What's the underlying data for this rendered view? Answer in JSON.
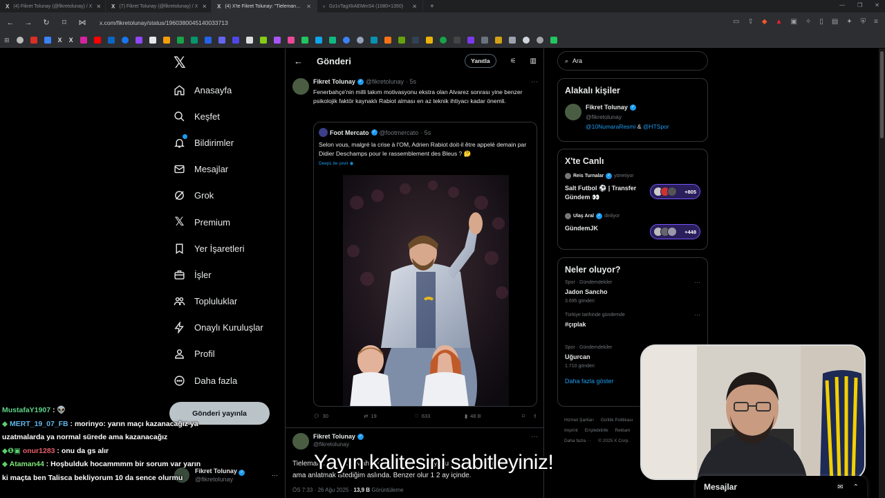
{
  "browser": {
    "tabs": [
      {
        "title": "(4) Fikret Tolunay (@fikretolunay) / X",
        "active": false
      },
      {
        "title": "(7) Fikret Tolunay (@fikretolunay) / X",
        "active": false
      },
      {
        "title": "(4) X'te Fikret Tolunay: \"Tieleman…",
        "active": true
      },
      {
        "title": "Gz1vTagXkAEMmS4 (1080×1350)",
        "active": false
      }
    ],
    "url": "x.com/fikretolunay/status/1960380045140033713"
  },
  "sidebar": {
    "items": [
      {
        "label": "Anasayfa",
        "icon": "home-icon"
      },
      {
        "label": "Keşfet",
        "icon": "search-icon"
      },
      {
        "label": "Bildirimler",
        "icon": "bell-icon"
      },
      {
        "label": "Mesajlar",
        "icon": "mail-icon"
      },
      {
        "label": "Grok",
        "icon": "grok-icon"
      },
      {
        "label": "Premium",
        "icon": "x-icon"
      },
      {
        "label": "Yer İşaretleri",
        "icon": "bookmark-icon"
      },
      {
        "label": "İşler",
        "icon": "briefcase-icon"
      },
      {
        "label": "Topluluklar",
        "icon": "people-icon"
      },
      {
        "label": "Onaylı Kuruluşlar",
        "icon": "lightning-icon"
      },
      {
        "label": "Profil",
        "icon": "person-icon"
      },
      {
        "label": "Daha fazla",
        "icon": "more-circle-icon"
      }
    ],
    "post_button": "Gönderi yayınla",
    "account": {
      "name": "Fikret Tolunay",
      "handle": "@fikretolunay"
    }
  },
  "main": {
    "title": "Gönderi",
    "reply_label": "Yanıtla",
    "tweet": {
      "name": "Fikret Tolunay",
      "handle": "@fikretolunay",
      "time": "· 5s",
      "text": "Fenerbahçe'nin milli takım motivasyonu ekstra olan Alvarez sonrası yine benzer psikolojik faktör kaynaklı Rabiot alması en az teknik ihtiyacı kadar önemli.",
      "quote": {
        "name": "Foot Mercato",
        "handle": "@footmercato",
        "time": "· 5s",
        "text": "Selon vous, malgré la crise à l'OM, Adrien Rabiot doit-il être appelé demain par Didier Deschamps pour le rassemblement des Bleus ? 🤔",
        "translate": "DeepL ile çevir"
      },
      "stats": {
        "replies": "30",
        "retweets": "19",
        "likes": "633",
        "views": "48 B"
      }
    },
    "tweet2": {
      "name": "Fikret Tolunay",
      "handle": "@fikretolunay",
      "text_line1": "Tieleman… Ekim'de Mahmutoğlu Rabiot pozisyonu fikir verir ki böyle",
      "text_line2": "ama anlatmak istediğim aslında. Benzer olur 1 2 ay içinde.",
      "time": "ÖS 7:33 · 26 Ağu 2025 ·",
      "views": "13,9 B",
      "views_label": "Görüntüleme"
    }
  },
  "right": {
    "search_placeholder": "Ara",
    "related": {
      "title": "Alakalı kişiler",
      "name": "Fikret Tolunay",
      "handle": "@fikretolunay",
      "link1": "@10NumaraResmi",
      "amp": "&",
      "link2": "@HTSpor"
    },
    "live": {
      "title": "X'te Canlı",
      "items": [
        {
          "host": "Reis Turnalar",
          "role": "yönetiyor",
          "title": "Salt Futbol ⚽ | Transfer Gündem 👀",
          "count": "+805"
        },
        {
          "host": "Ulaş Aral",
          "role": "dinliyor",
          "title": "GündemJK",
          "count": "+448"
        }
      ]
    },
    "trends": {
      "title": "Neler oluyor?",
      "items": [
        {
          "context": "Spor · Gündemdekiler",
          "name": "Jadon Sancho",
          "count": "3.695 gönderi"
        },
        {
          "context": "Türkiye tarihinde gündemde",
          "name": "#çıplak",
          "count": ""
        },
        {
          "context": "Spor · Gündemdekiler",
          "name": "Uğurcan",
          "count": "1.710 gönderi"
        }
      ],
      "show_more": "Daha fazla göster"
    },
    "footer": [
      "Hizmet Şartları",
      "Gizlilik Politikası",
      "Imprint",
      "Erişilebilirlik",
      "Reklam",
      "Daha fazla ···",
      "© 2025 X Corp."
    ]
  },
  "messages_drawer": {
    "title": "Mesajlar"
  },
  "overlay": {
    "chat": [
      {
        "user": "MustafaY1907",
        "sep": " : ",
        "msg": "👽",
        "prefix": ""
      },
      {
        "user": "MERT_19_07_FB",
        "sep": " : ",
        "msg": "morinyo: yarın maçı kazanacağız ya uzatmalarda ya normal sürede ama kazanacağız",
        "prefix": "◆ "
      },
      {
        "user": "onur1283",
        "sep": " : ",
        "msg": "onu da gs alır",
        "prefix": "◆❶▣ "
      },
      {
        "user": "Ataman44",
        "sep": " : ",
        "msg": "Hoşbulduk hocammmm bir sorum var yarın ki maçta ben Talisca bekliyorum 10 da sence olurmu",
        "prefix": "◆ "
      }
    ],
    "subtitle": "Yayın kalitesini sabitleyiniz!"
  }
}
